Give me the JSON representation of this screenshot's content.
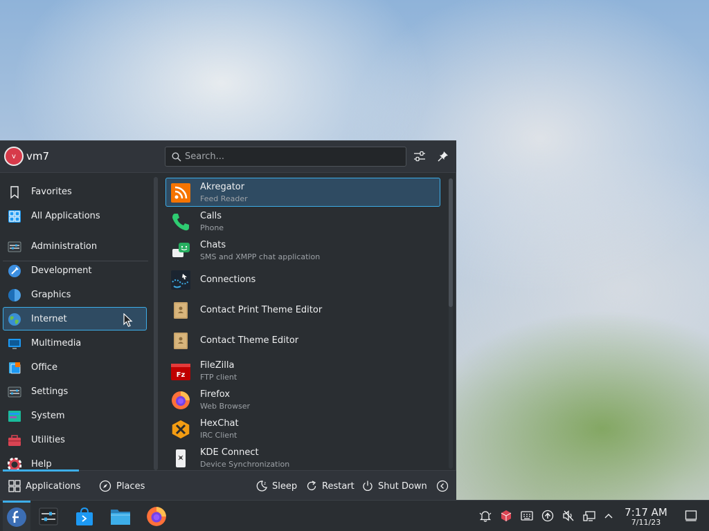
{
  "user": {
    "avatar_letter": "v",
    "name": "vm7"
  },
  "search": {
    "placeholder": "Search..."
  },
  "categories": [
    {
      "label": "Favorites",
      "icon": "bookmark-icon"
    },
    {
      "label": "All Applications",
      "icon": "grid-icon"
    },
    {
      "label": "Administration",
      "icon": "admin-icon"
    },
    {
      "label": "Development",
      "icon": "development-icon"
    },
    {
      "label": "Graphics",
      "icon": "graphics-icon"
    },
    {
      "label": "Internet",
      "icon": "globe-icon",
      "active": true
    },
    {
      "label": "Multimedia",
      "icon": "multimedia-icon"
    },
    {
      "label": "Office",
      "icon": "office-icon"
    },
    {
      "label": "Settings",
      "icon": "settings-icon"
    },
    {
      "label": "System",
      "icon": "system-icon"
    },
    {
      "label": "Utilities",
      "icon": "utilities-icon"
    },
    {
      "label": "Help",
      "icon": "help-icon"
    }
  ],
  "apps": [
    {
      "name": "Akregator",
      "desc": "Feed Reader",
      "icon": "rss-icon",
      "active": true
    },
    {
      "name": "Calls",
      "desc": "Phone",
      "icon": "phone-icon"
    },
    {
      "name": "Chats",
      "desc": "SMS and XMPP chat application",
      "icon": "chat-icon"
    },
    {
      "name": "Connections",
      "desc": "",
      "icon": "connections-icon"
    },
    {
      "name": "Contact Print Theme Editor",
      "desc": "",
      "icon": "contact-print-theme-icon"
    },
    {
      "name": "Contact Theme Editor",
      "desc": "",
      "icon": "contact-theme-icon"
    },
    {
      "name": "FileZilla",
      "desc": "FTP client",
      "icon": "filezilla-icon"
    },
    {
      "name": "Firefox",
      "desc": "Web Browser",
      "icon": "firefox-icon"
    },
    {
      "name": "HexChat",
      "desc": "IRC Client",
      "icon": "hexchat-icon"
    },
    {
      "name": "KDE Connect",
      "desc": "Device Synchronization",
      "icon": "kdeconnect-icon"
    }
  ],
  "footer": {
    "applications_label": "Applications",
    "places_label": "Places",
    "sleep_label": "Sleep",
    "restart_label": "Restart",
    "shutdown_label": "Shut Down"
  },
  "taskbar": {
    "pinned": [
      "fedora-launcher-icon",
      "system-settings-icon",
      "discover-store-icon",
      "file-manager-icon",
      "firefox-icon"
    ],
    "tray": [
      "notifications-icon",
      "package-icon",
      "keyboard-icon",
      "updates-icon",
      "volume-muted-icon",
      "network-icon",
      "expand-tray-icon"
    ],
    "clock_time": "7:17 AM",
    "clock_date": "7/11/23"
  },
  "colors": {
    "accent": "#3daee9",
    "panel": "#2a2e32",
    "selection": "#2f4b62"
  }
}
